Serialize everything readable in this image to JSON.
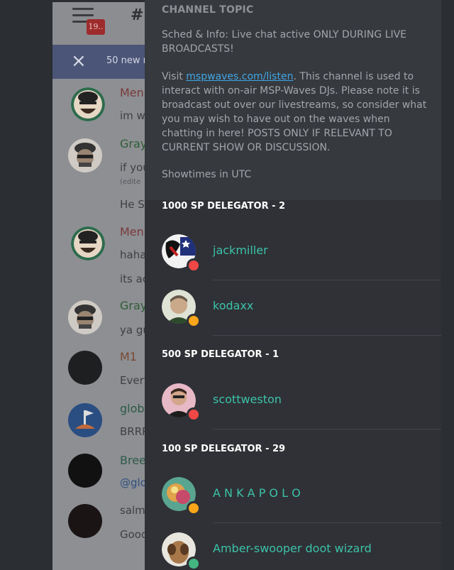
{
  "chat": {
    "badge_count": "19..",
    "channel_prefix": "#r",
    "banner_close": "×",
    "banner_text": "50 new r",
    "messages": [
      {
        "name": "Men",
        "name_color": "#7a3a3a",
        "text": "im w"
      },
      {
        "name": "Gray",
        "name_color": "#2f5d35",
        "text": "if you",
        "edited": "(edite",
        "text2": "He S"
      },
      {
        "name": "Men",
        "name_color": "#7a3a3a",
        "text": "haha",
        "text2": "its ac"
      },
      {
        "name": "Gray",
        "name_color": "#2f5d35",
        "text": "ya gu"
      },
      {
        "name": "M1",
        "name_color": "#7a4a33",
        "text": "Every"
      },
      {
        "name": "globi",
        "name_color": "#2d5a46",
        "text": "BRRR"
      },
      {
        "name": "Breez",
        "name_color": "#2d5a46",
        "text": "@glo"
      },
      {
        "name": "",
        "name_color": "#3d3f43",
        "text": "salm",
        "text2": "Good"
      }
    ]
  },
  "topic": {
    "title": "CHANNEL TOPIC",
    "line1": "Sched & Info: Live chat active ONLY DURING LIVE BROADCASTS!",
    "visit_prefix": "Visit ",
    "link_text": "mspwaves.com/listen",
    "line2_rest": ". This channel is used to interact with on-air MSP-Waves DJs. Please note it is broadcast out over our livestreams, so consider what you may wish to have out on the waves when chatting in here! POSTS ONLY IF RELEVANT TO CURRENT SHOW OR DISCUSSION.",
    "line3": "Showtimes in UTC"
  },
  "members": {
    "groups": [
      {
        "label": "1000 SP DELEGATOR - 2",
        "users": [
          {
            "name": "jackmiller",
            "status": "dnd",
            "status_color": "#f04747"
          },
          {
            "name": "kodaxx",
            "status": "idle",
            "status_color": "#faa61a"
          }
        ]
      },
      {
        "label": "500 SP DELEGATOR - 1",
        "users": [
          {
            "name": "scottweston",
            "status": "dnd",
            "status_color": "#f04747"
          }
        ]
      },
      {
        "label": "100 SP DELEGATOR - 29",
        "users": [
          {
            "name": "A N K A P O L O",
            "status": "idle",
            "status_color": "#faa61a"
          },
          {
            "name": "Amber-swooper doot wizard",
            "status": "online",
            "status_color": "#43b581"
          }
        ]
      }
    ]
  }
}
